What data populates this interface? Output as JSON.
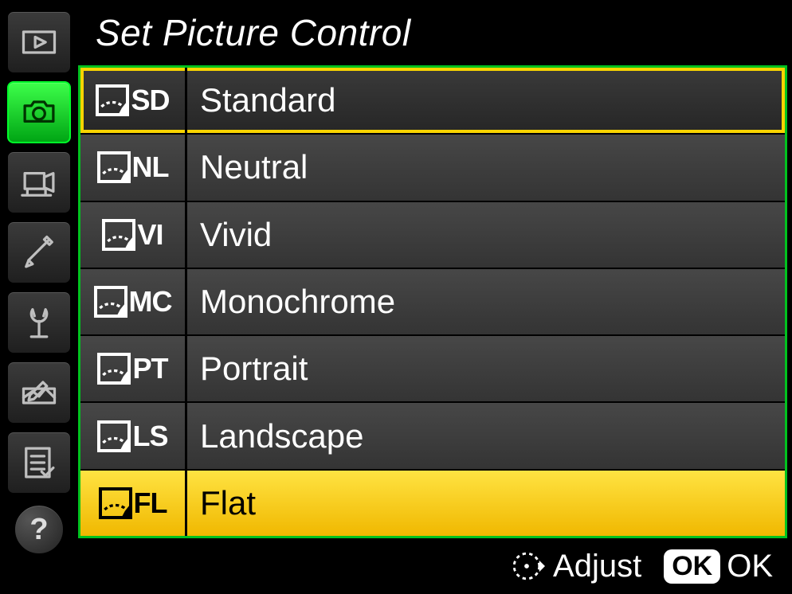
{
  "title": "Set Picture Control",
  "sidebar": [
    {
      "icon": "playback"
    },
    {
      "icon": "photo-shooting",
      "active": true
    },
    {
      "icon": "movie-shooting"
    },
    {
      "icon": "custom-settings"
    },
    {
      "icon": "setup"
    },
    {
      "icon": "retouch"
    },
    {
      "icon": "my-menu"
    }
  ],
  "options": [
    {
      "code": "SD",
      "label": "Standard",
      "current": true
    },
    {
      "code": "NL",
      "label": "Neutral"
    },
    {
      "code": "VI",
      "label": "Vivid"
    },
    {
      "code": "MC",
      "label": "Monochrome"
    },
    {
      "code": "PT",
      "label": "Portrait"
    },
    {
      "code": "LS",
      "label": "Landscape"
    },
    {
      "code": "FL",
      "label": "Flat",
      "selected": true
    }
  ],
  "footer": {
    "adjust_label": "Adjust",
    "ok_badge": "OK",
    "ok_label": "OK"
  },
  "help_symbol": "?"
}
